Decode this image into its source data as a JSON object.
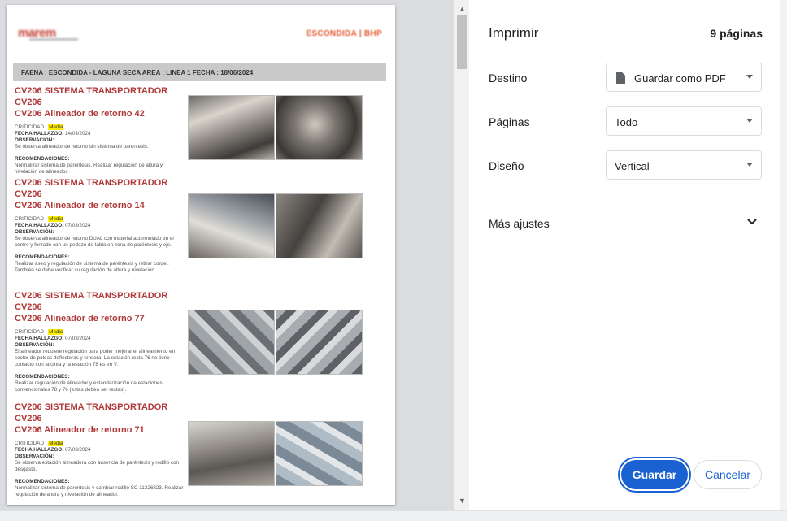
{
  "document": {
    "brand": "ESCONDIDA | BHP",
    "logo": "marem",
    "faena_bar": "FAENA : ESCONDIDA - LAGUNA SECA     AREA : LINEA 1   FECHA : 18/06/2024",
    "findings": [
      {
        "title_line1": "CV206 SISTEMA TRANSPORTADOR CV206",
        "title_line2": "CV206 Alineador de retorno 42",
        "crit_label": "CRITICIDAD :",
        "crit_value": "Media",
        "fecha_label": "FECHA HALLAZGO:",
        "fecha_value": "14/03/2024",
        "obs_label": "OBSERVACIÓN:",
        "obs_text": "Se observa alineador de retorno sin sistema de parentesis.",
        "reco_label": "RECOMENDACIONES:",
        "reco_text": "Normalizar sistema de paréntesis. Realizar regulación de altura y nivelación de alineador."
      },
      {
        "title_line1": "CV206 SISTEMA TRANSPORTADOR CV206",
        "title_line2": "CV206 Alineador de retorno 14",
        "crit_label": "CRITICIDAD :",
        "crit_value": "Media",
        "fecha_label": "FECHA HALLAZGO:",
        "fecha_value": "07/03/2024",
        "obs_label": "OBSERVACIÓN:",
        "obs_text": "Se observa alineador de retorno DUAL con material acumnulado en el centro y forzado con un pedazo de tabla en zona de paréntesis y eje.",
        "reco_label": "RECOMENDACIONES:",
        "reco_text": "Realizar aseo y regulación de sistema de paréntesis y retirar cordel. También se debe verificar su regulación de altura y nivelación."
      },
      {
        "title_line1": "CV206 SISTEMA TRANSPORTADOR CV206",
        "title_line2": "CV206 Alineador de retorno 77",
        "crit_label": "CRITICIDAD :",
        "crit_value": "Media",
        "fecha_label": "FECHA HALLAZGO:",
        "fecha_value": "07/03/2024",
        "obs_label": "OBSERVACIÓN:",
        "obs_text": "El alineador requiere regulación para poder mejorar el alineamiento en sector de poleas deflectoras y tensora. La estación recta 76 no tiene contacto con la cinta y la estación 78 es en V.",
        "reco_label": "RECOMENDACIONES:",
        "reco_text": "Realizar regulación de alineador y estandarización de estaciones convencionales 78 y 76 (estas deben ser rectas)."
      },
      {
        "title_line1": "CV206 SISTEMA TRANSPORTADOR CV206",
        "title_line2": "CV206 Alineador de retorno 71",
        "crit_label": "CRITICIDAD :",
        "crit_value": "Media",
        "fecha_label": "FECHA HALLAZGO:",
        "fecha_value": "07/03/2024",
        "obs_label": "OBSERVACIÓN:",
        "obs_text": "Se observa estación alineadora con ausencia de paréntesis y rodillo con desgaste.",
        "reco_label": "RECOMENDACIONES:",
        "reco_text": "Normalizar sistema de paréntesis y cambiar rodillo SC 11326823. Realizar regulación de altura y nivelación de alineador."
      }
    ]
  },
  "panel": {
    "title": "Imprimir",
    "page_count": "9 páginas",
    "destino_label": "Destino",
    "destino_value": "Guardar como PDF",
    "paginas_label": "Páginas",
    "paginas_value": "Todo",
    "diseno_label": "Diseño",
    "diseno_value": "Vertical",
    "more_settings": "Más ajustes",
    "save_label": "Guardar",
    "cancel_label": "Cancelar"
  },
  "colors": {
    "accent": "#1a62d2",
    "title_red": "#b03a3a",
    "highlight": "#ffee00"
  }
}
